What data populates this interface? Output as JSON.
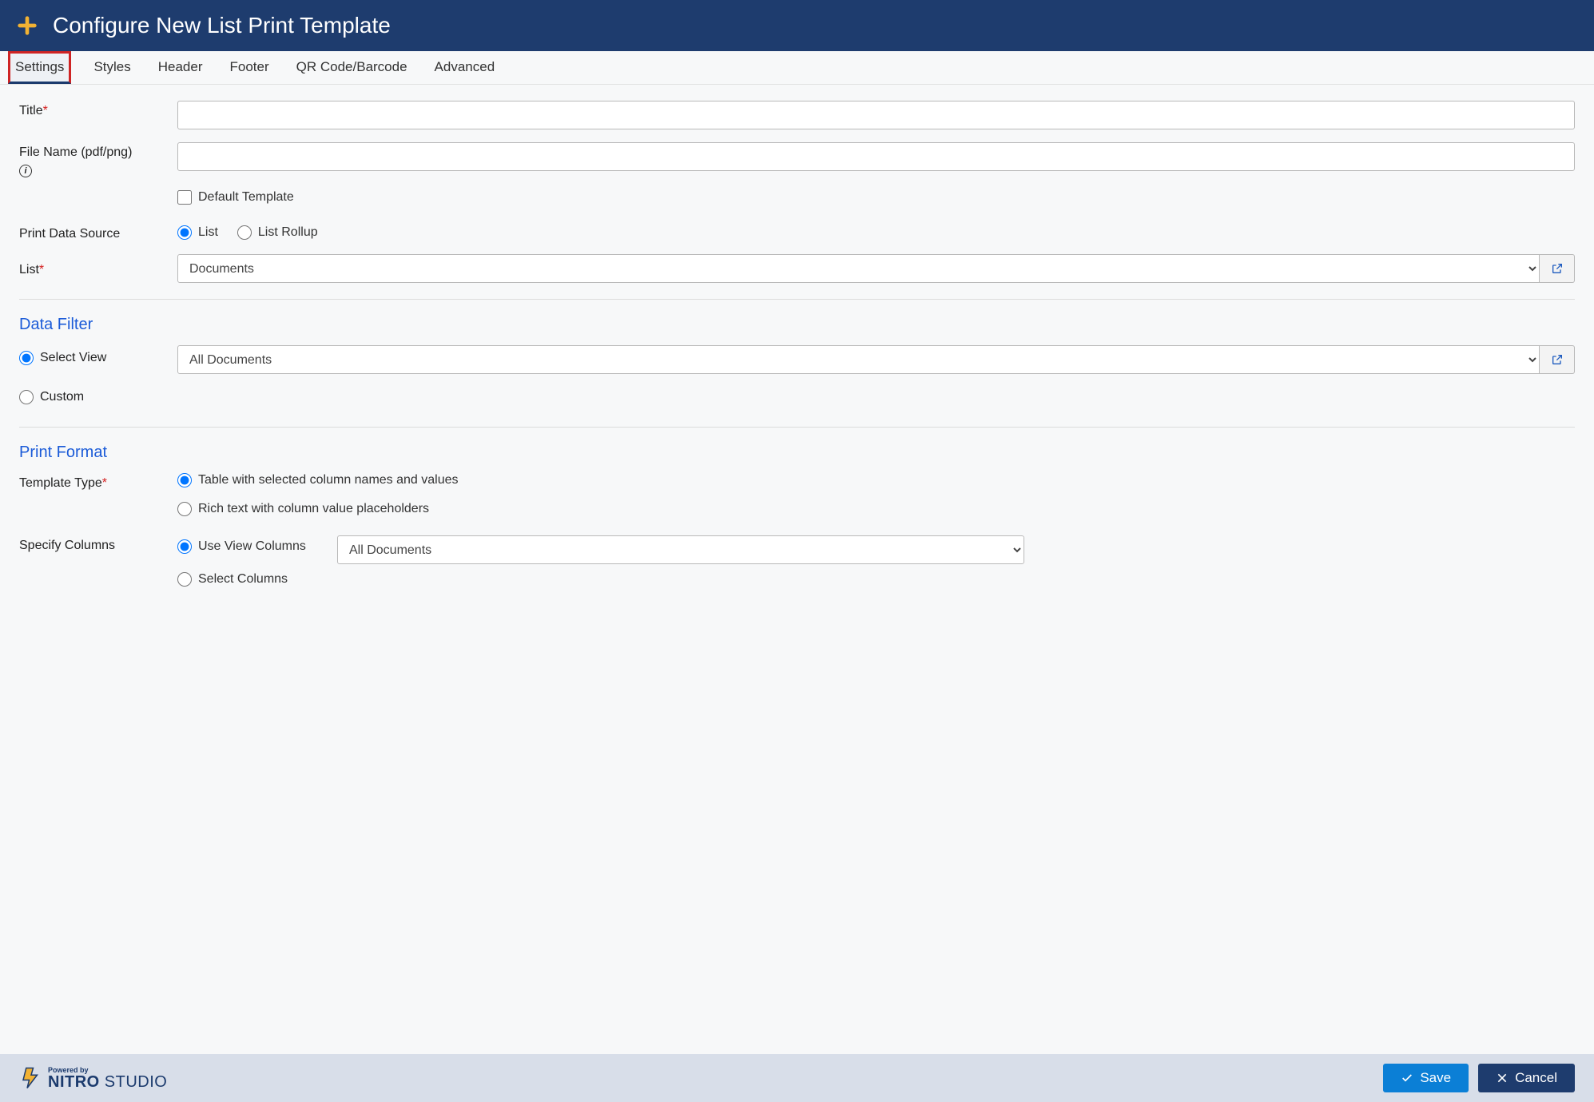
{
  "header": {
    "title": "Configure New List Print Template"
  },
  "tabs": [
    {
      "label": "Settings",
      "active": true
    },
    {
      "label": "Styles",
      "active": false
    },
    {
      "label": "Header",
      "active": false
    },
    {
      "label": "Footer",
      "active": false
    },
    {
      "label": "QR Code/Barcode",
      "active": false
    },
    {
      "label": "Advanced",
      "active": false
    }
  ],
  "fields": {
    "title_label": "Title",
    "title_value": "",
    "filename_label": "File Name (pdf/png)",
    "filename_value": "",
    "default_template_label": "Default Template",
    "default_template_checked": false,
    "print_data_source_label": "Print Data Source",
    "data_source_options": {
      "list": "List",
      "rollup": "List Rollup",
      "selected": "list"
    },
    "list_label": "List",
    "list_value": "Documents"
  },
  "data_filter": {
    "section_title": "Data Filter",
    "select_view_label": "Select View",
    "custom_label": "Custom",
    "selected": "select_view",
    "view_value": "All Documents"
  },
  "print_format": {
    "section_title": "Print Format",
    "template_type_label": "Template Type",
    "template_options": {
      "table": "Table with selected column names and values",
      "richtext": "Rich text with column value placeholders",
      "selected": "table"
    },
    "specify_columns_label": "Specify Columns",
    "column_options": {
      "view": "Use View Columns",
      "select": "Select Columns",
      "selected": "view"
    },
    "view_columns_value": "All Documents"
  },
  "footer": {
    "powered_by": "Powered by",
    "brand_bold": "NITRO",
    "brand_thin": "STUDIO",
    "save_label": "Save",
    "cancel_label": "Cancel"
  }
}
